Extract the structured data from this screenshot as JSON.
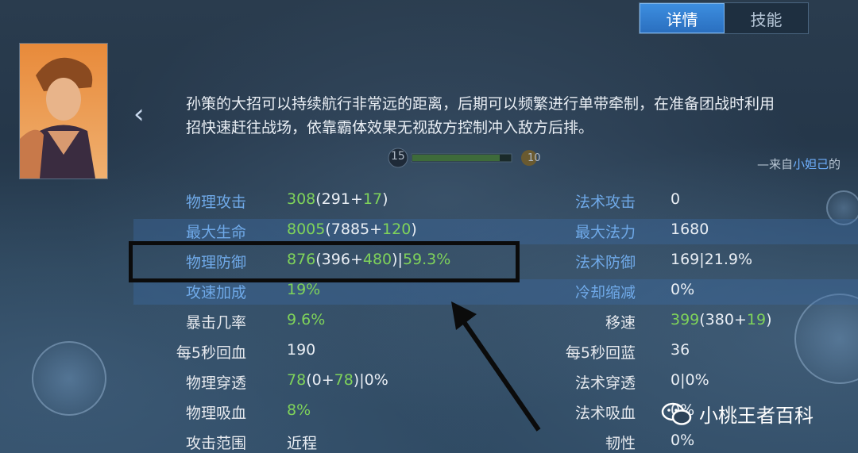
{
  "tabs": [
    {
      "label": "详情",
      "active": true
    },
    {
      "label": "技能",
      "active": false
    }
  ],
  "description": {
    "line1": "孙策的大招可以持续航行非常远的距离，后期可以频繁进行单带牵制，在准备团战时利用",
    "line2": "招快速赶往战场，依靠霸体效果无视敌方控制冲入敌方后排。"
  },
  "source": {
    "prefix": "—来自",
    "name": "小妲己",
    "suffix": "的"
  },
  "level_bar": {
    "left": "15",
    "right": "10"
  },
  "left_stats": [
    {
      "label": "物理攻击",
      "value_parts": [
        [
          "g",
          "308"
        ],
        [
          "w",
          "(291+"
        ],
        [
          "g",
          "17"
        ],
        [
          "w",
          ")"
        ]
      ],
      "blue": true
    },
    {
      "label": "最大生命",
      "value_parts": [
        [
          "g",
          "8005"
        ],
        [
          "w",
          "(7885+"
        ],
        [
          "g",
          "120"
        ],
        [
          "w",
          ")"
        ]
      ],
      "blue": true
    },
    {
      "label": "物理防御",
      "value_parts": [
        [
          "g",
          "876"
        ],
        [
          "w",
          "(396+"
        ],
        [
          "g",
          "480"
        ],
        [
          "w",
          ")|"
        ],
        [
          "g",
          "59.3%"
        ]
      ],
      "blue": true
    },
    {
      "label": "攻速加成",
      "value_parts": [
        [
          "g",
          "19%"
        ]
      ],
      "blue": true
    },
    {
      "label": "暴击几率",
      "value_parts": [
        [
          "g",
          "9.6%"
        ]
      ],
      "blue": false
    },
    {
      "label": "每5秒回血",
      "value_parts": [
        [
          "w",
          "190"
        ]
      ],
      "blue": false
    },
    {
      "label": "物理穿透",
      "value_parts": [
        [
          "g",
          "78"
        ],
        [
          "w",
          "(0+"
        ],
        [
          "g",
          "78"
        ],
        [
          "w",
          ")|0%"
        ]
      ],
      "blue": false
    },
    {
      "label": "物理吸血",
      "value_parts": [
        [
          "g",
          "8%"
        ]
      ],
      "blue": false
    },
    {
      "label": "攻击范围",
      "value_parts": [
        [
          "w",
          "近程"
        ]
      ],
      "blue": false
    }
  ],
  "right_stats": [
    {
      "label": "法术攻击",
      "value_parts": [
        [
          "w",
          "0"
        ]
      ],
      "blue": true
    },
    {
      "label": "最大法力",
      "value_parts": [
        [
          "w",
          "1680"
        ]
      ],
      "blue": true
    },
    {
      "label": "法术防御",
      "value_parts": [
        [
          "w",
          "169|21.9%"
        ]
      ],
      "blue": true
    },
    {
      "label": "冷却缩减",
      "value_parts": [
        [
          "w",
          "0%"
        ]
      ],
      "blue": true
    },
    {
      "label": "移速",
      "value_parts": [
        [
          "g",
          "399"
        ],
        [
          "w",
          "(380+"
        ],
        [
          "g",
          "19"
        ],
        [
          "w",
          ")"
        ]
      ],
      "blue": false
    },
    {
      "label": "每5秒回蓝",
      "value_parts": [
        [
          "w",
          "36"
        ]
      ],
      "blue": false
    },
    {
      "label": "法术穿透",
      "value_parts": [
        [
          "w",
          "0|0%"
        ]
      ],
      "blue": false
    },
    {
      "label": "法术吸血",
      "value_parts": [
        [
          "w",
          "0%"
        ]
      ],
      "blue": false
    },
    {
      "label": "韧性",
      "value_parts": [
        [
          "w",
          "0%"
        ]
      ],
      "blue": false
    }
  ],
  "watermark": {
    "text": "小桃王者百科",
    "icon": "wechat-icon"
  },
  "colors": {
    "accent_blue": "#6fa9e8",
    "accent_green": "#7fd35a",
    "tab_active": "#2f7fd0"
  }
}
